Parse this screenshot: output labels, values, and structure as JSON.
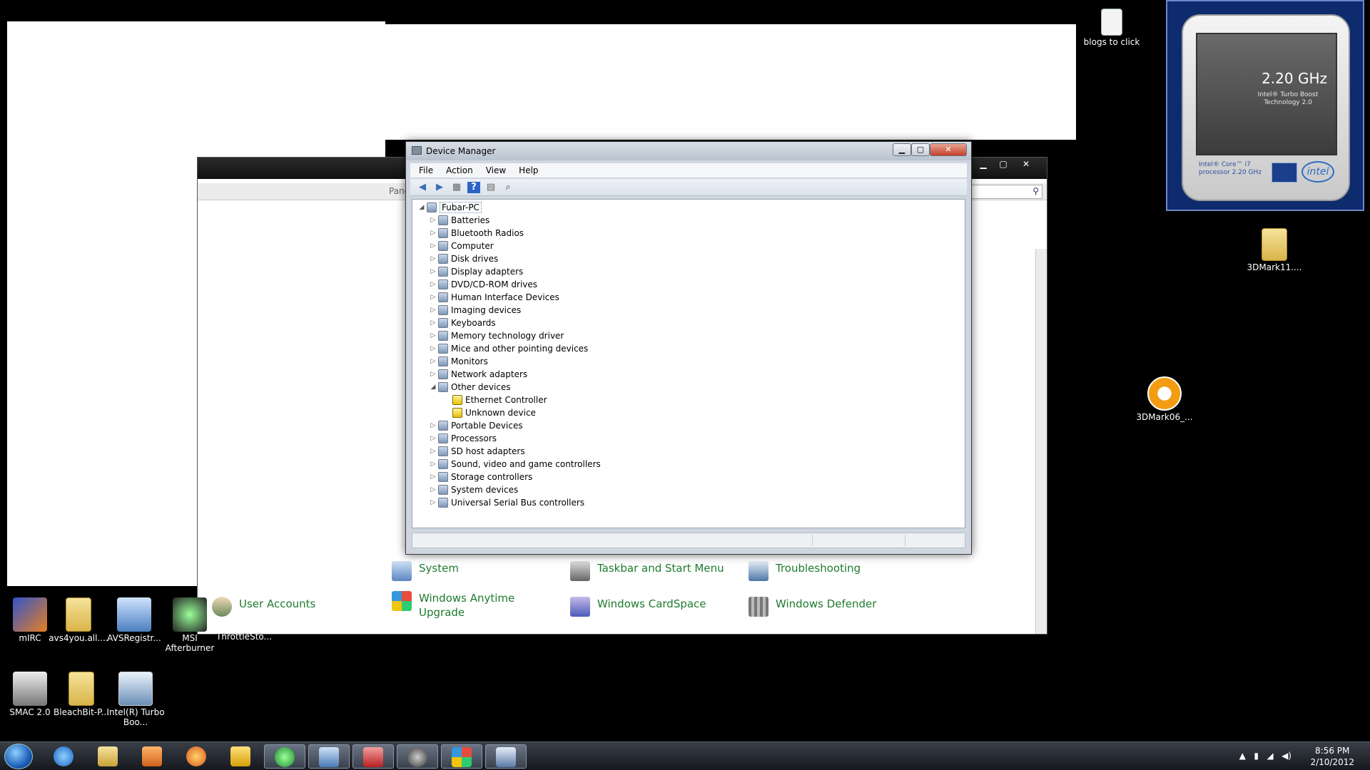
{
  "desktop": {
    "icons": [
      {
        "label": "blogs to click"
      },
      {
        "label": "3DMark11...."
      },
      {
        "label": "3DMark06_..."
      },
      {
        "label": "mIRC"
      },
      {
        "label": "avs4you.all...."
      },
      {
        "label": "AVSRegistr..."
      },
      {
        "label": "MSI Afterburner"
      },
      {
        "label": "ThrottleSto..."
      },
      {
        "label": "SMAC 2.0"
      },
      {
        "label": "BleachBit-P..."
      },
      {
        "label": "Intel(R) Turbo Boo..."
      }
    ]
  },
  "control_panel": {
    "address_text": "Pane",
    "items": [
      {
        "label": "System",
        "icon": "system-icon"
      },
      {
        "label": "Taskbar and Start Menu",
        "icon": "taskbar-icon"
      },
      {
        "label": "Troubleshooting",
        "icon": "troubleshooting-icon"
      },
      {
        "label": "User Accounts",
        "icon": "user-accounts-icon"
      },
      {
        "label": "Windows Anytime Upgrade",
        "icon": "windows-flag-icon"
      },
      {
        "label": "Windows CardSpace",
        "icon": "cardspace-icon"
      },
      {
        "label": "Windows Defender",
        "icon": "defender-icon"
      }
    ]
  },
  "device_manager": {
    "title": "Device Manager",
    "menu": [
      "File",
      "Action",
      "View",
      "Help"
    ],
    "root": "Fubar-PC",
    "categories": [
      {
        "label": "Batteries",
        "icon": "battery-icon"
      },
      {
        "label": "Bluetooth Radios",
        "icon": "bluetooth-icon"
      },
      {
        "label": "Computer",
        "icon": "computer-icon"
      },
      {
        "label": "Disk drives",
        "icon": "disk-drive-icon"
      },
      {
        "label": "Display adapters",
        "icon": "display-adapter-icon"
      },
      {
        "label": "DVD/CD-ROM drives",
        "icon": "dvd-icon"
      },
      {
        "label": "Human Interface Devices",
        "icon": "hid-icon"
      },
      {
        "label": "Imaging devices",
        "icon": "camera-icon"
      },
      {
        "label": "Keyboards",
        "icon": "keyboard-icon"
      },
      {
        "label": "Memory technology driver",
        "icon": "memory-icon"
      },
      {
        "label": "Mice and other pointing devices",
        "icon": "mouse-icon"
      },
      {
        "label": "Monitors",
        "icon": "monitor-icon"
      },
      {
        "label": "Network adapters",
        "icon": "network-adapter-icon"
      },
      {
        "label": "Other devices",
        "icon": "unknown-device-icon",
        "expanded": true
      },
      {
        "label": "Ethernet Controller",
        "icon": "warning-icon",
        "child": true
      },
      {
        "label": "Unknown device",
        "icon": "warning-icon",
        "child": true
      },
      {
        "label": "Portable Devices",
        "icon": "portable-device-icon"
      },
      {
        "label": "Processors",
        "icon": "processor-icon"
      },
      {
        "label": "SD host adapters",
        "icon": "sd-card-icon"
      },
      {
        "label": "Sound, video and game controllers",
        "icon": "speaker-icon"
      },
      {
        "label": "Storage controllers",
        "icon": "storage-icon"
      },
      {
        "label": "System devices",
        "icon": "system-device-icon"
      },
      {
        "label": "Universal Serial Bus controllers",
        "icon": "usb-icon"
      }
    ]
  },
  "gadget": {
    "speed": "2.20 GHz",
    "turbo_line1": "Intel® Turbo Boost",
    "turbo_line2": "Technology 2.0",
    "core_line1": "Intel® Core™ i7",
    "core_line2": "processor 2.20 GHz",
    "logo": "intel"
  },
  "taskbar": {
    "time": "8:56 PM",
    "date": "2/10/2012"
  }
}
